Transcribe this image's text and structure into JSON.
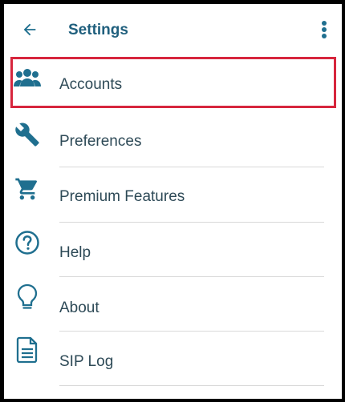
{
  "header": {
    "title": "Settings",
    "back_icon": "arrow-left-icon",
    "menu_icon": "more-vertical-icon"
  },
  "menu": {
    "items": [
      {
        "label": "Accounts",
        "icon": "users-icon",
        "selected": true
      },
      {
        "label": "Preferences",
        "icon": "wrench-icon"
      },
      {
        "label": "Premium Features",
        "icon": "cart-icon"
      },
      {
        "label": "Help",
        "icon": "help-circle-icon"
      },
      {
        "label": "About",
        "icon": "lightbulb-icon"
      },
      {
        "label": "SIP Log",
        "icon": "document-icon"
      }
    ]
  },
  "colors": {
    "accent": "#1f6f8f",
    "title": "#1f5f7d",
    "highlight_border": "#d7263d",
    "divider": "#d9d9d9"
  }
}
